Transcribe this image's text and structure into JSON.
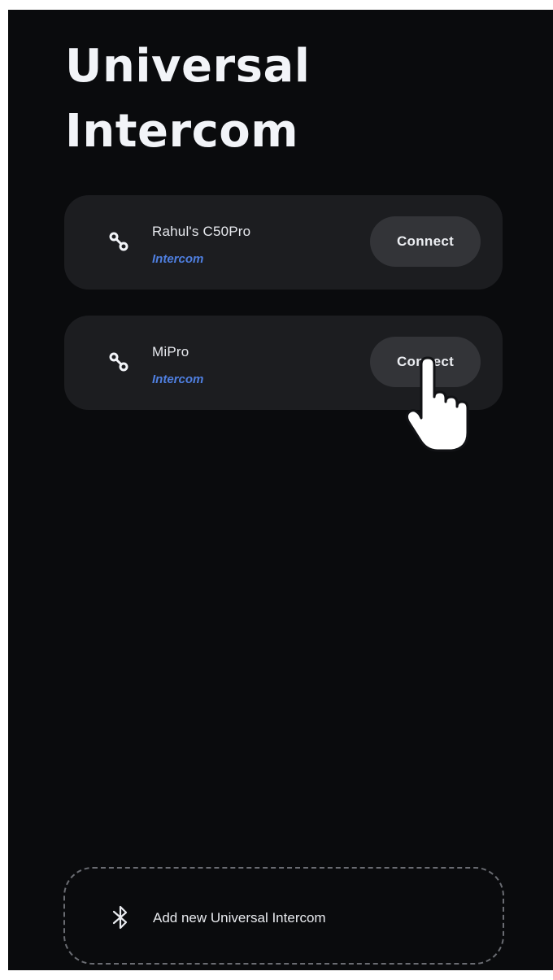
{
  "header": {
    "title_line1": "Universal",
    "title_line2": "Intercom"
  },
  "devices": [
    {
      "name": "Rahul's C50Pro",
      "type": "Intercom",
      "connect_label": "Connect",
      "icon": "link-icon"
    },
    {
      "name": "MiPro",
      "type": "Intercom",
      "connect_label": "Connect",
      "icon": "link-icon"
    }
  ],
  "add_device": {
    "label": "Add new Universal Intercom",
    "icon": "bluetooth-icon"
  },
  "colors": {
    "background": "#0a0b0d",
    "card": "#1c1d20",
    "button": "#333438",
    "accent": "#4f7fe0"
  }
}
